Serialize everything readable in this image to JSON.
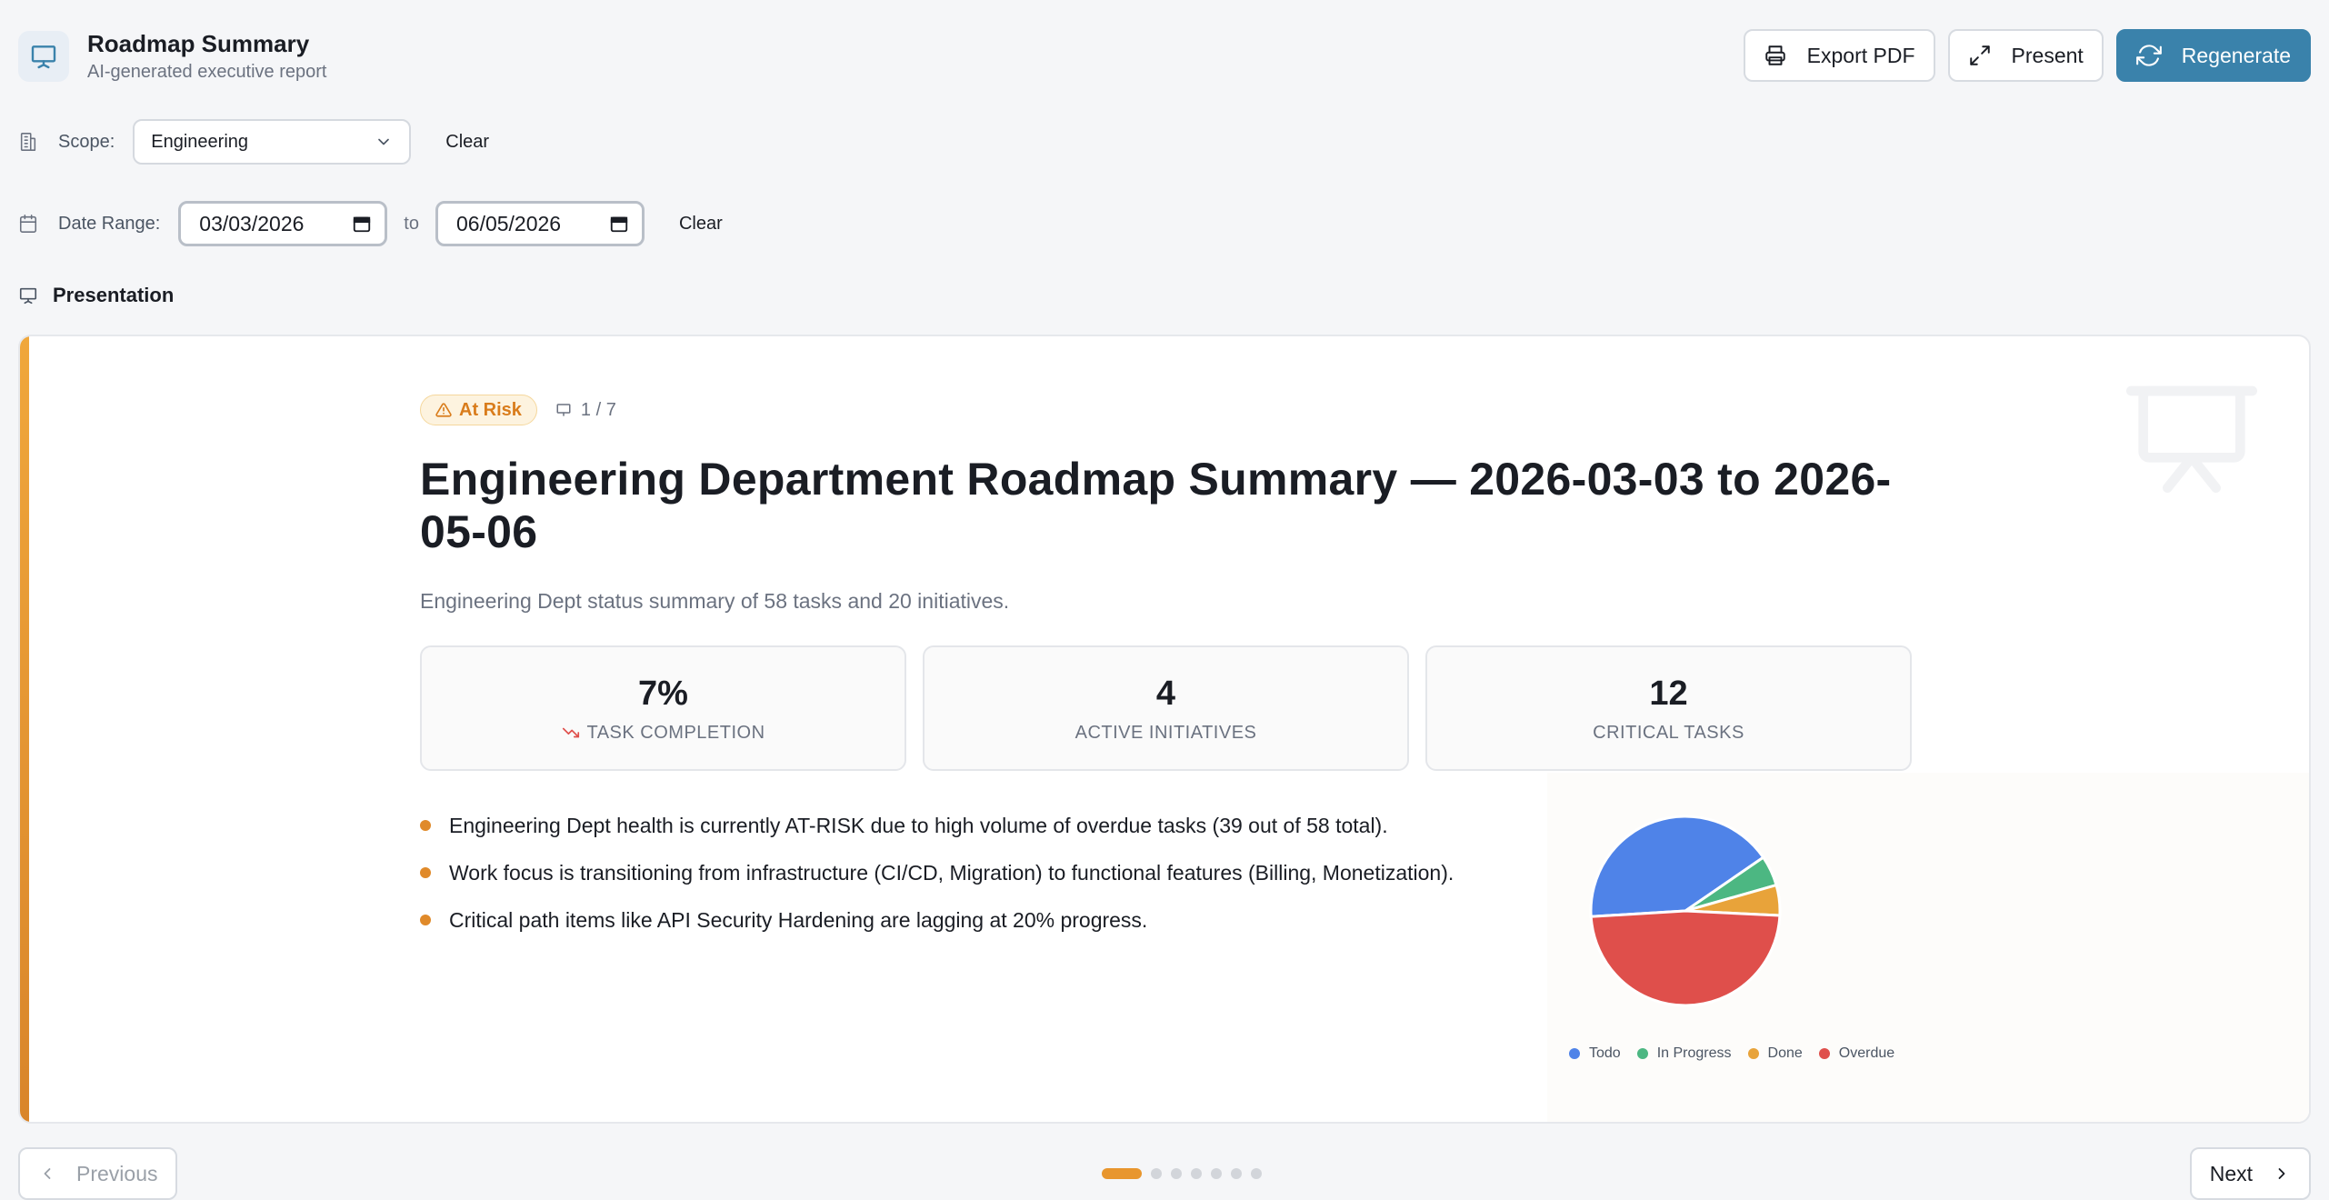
{
  "header": {
    "title": "Roadmap Summary",
    "subtitle": "AI-generated executive report",
    "actions": {
      "export_label": "Export PDF",
      "present_label": "Present",
      "regenerate_label": "Regenerate"
    }
  },
  "filters": {
    "scope_label": "Scope:",
    "scope_value": "Engineering",
    "scope_clear": "Clear",
    "date_label": "Date Range:",
    "date_from": "03/03/2026",
    "date_to_label": "to",
    "date_to": "06/05/2026",
    "date_clear": "Clear"
  },
  "section": {
    "label": "Presentation"
  },
  "slide": {
    "status": "At Risk",
    "counter": "1 / 7",
    "title": "Engineering Department Roadmap Summary — 2026-03-03 to 2026-05-06",
    "description": "Engineering Dept status summary of 58 tasks and 20 initiatives.",
    "kpis": [
      {
        "value": "7%",
        "label": "TASK COMPLETION",
        "trend": "down"
      },
      {
        "value": "4",
        "label": "ACTIVE INITIATIVES"
      },
      {
        "value": "12",
        "label": "CRITICAL TASKS"
      }
    ],
    "bullets": [
      "Engineering Dept health is currently AT-RISK due to high volume of overdue tasks (39 out of 58 total).",
      "Work focus is transitioning from infrastructure (CI/CD, Migration) to functional features (Billing, Monetization).",
      "Critical path items like API Security Hardening are lagging at 20% progress."
    ]
  },
  "chart_data": {
    "type": "pie",
    "categories": [
      "Todo",
      "In Progress",
      "Done",
      "Overdue"
    ],
    "values": [
      24,
      3,
      3,
      28
    ],
    "colors": [
      "#4f83e8",
      "#4cb782",
      "#e8a33a",
      "#df4f4b"
    ]
  },
  "navigation": {
    "previous_label": "Previous",
    "next_label": "Next",
    "total_slides": 7,
    "current_slide": 1
  },
  "colors": {
    "primary": "#3a82ab",
    "accent": "#e8962e",
    "risk": "#d97c1b"
  }
}
